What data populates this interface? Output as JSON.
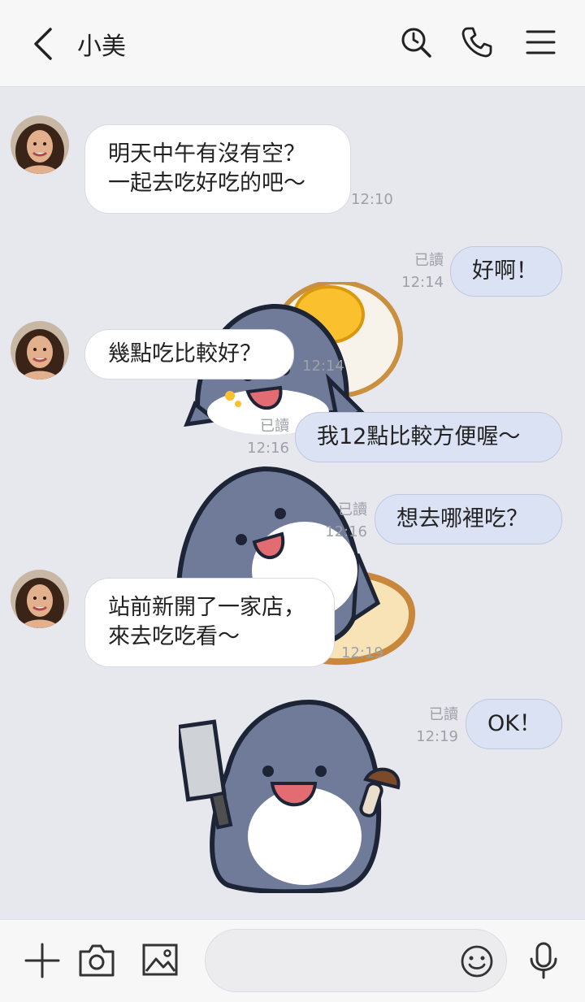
{
  "header": {
    "title": "小美",
    "icons": [
      "back-arrow-icon",
      "search-clock-icon",
      "phone-icon",
      "menu-icon"
    ]
  },
  "messages": [
    {
      "side": "in",
      "text": "明天中午有沒有空？\n一起去吃好吃的吧～",
      "time": "12:10"
    },
    {
      "side": "out",
      "text": "好啊！",
      "read": "已讀",
      "time": "12:14"
    },
    {
      "side": "in",
      "text": "幾點吃比較好？",
      "time": "12:14"
    },
    {
      "side": "out",
      "text": "我12點比較方便喔～",
      "read": "已讀",
      "time": "12:16"
    },
    {
      "side": "out",
      "text": "想去哪裡吃？",
      "read": "已讀",
      "time": "12:16"
    },
    {
      "side": "in",
      "text": "站前新開了一家店，\n來去吃吃看～",
      "time": "12:19"
    },
    {
      "side": "out",
      "text": "OK！",
      "read": "已讀",
      "time": "12:19"
    }
  ],
  "colors": {
    "background": "#e6e8ee",
    "incoming_bubble": "#ffffff",
    "outgoing_bubble": "#dbe2f4",
    "meta_text": "#9ea1a8"
  },
  "composer": {
    "icons": [
      "plus-icon",
      "camera-icon",
      "image-icon",
      "emoji-icon",
      "microphone-icon"
    ]
  }
}
